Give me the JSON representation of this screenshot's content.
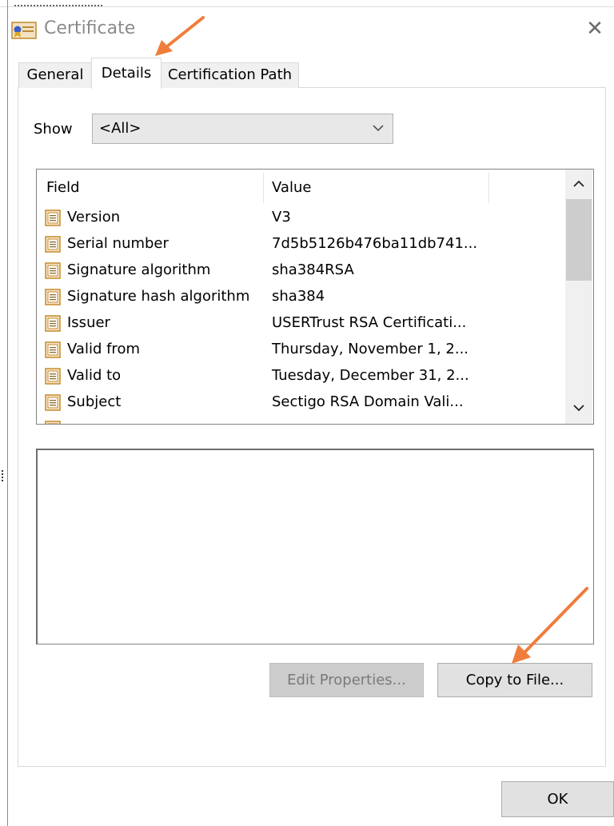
{
  "window": {
    "title": "Certificate",
    "close_glyph": "✕"
  },
  "tabs": [
    {
      "label": "General",
      "active": false
    },
    {
      "label": "Details",
      "active": true
    },
    {
      "label": "Certification Path",
      "active": false
    }
  ],
  "show": {
    "label": "Show",
    "selected": "<All>"
  },
  "list": {
    "columns": [
      "Field",
      "Value"
    ],
    "rows": [
      {
        "field": "Version",
        "value": "V3"
      },
      {
        "field": "Serial number",
        "value": "7d5b5126b476ba11db741..."
      },
      {
        "field": "Signature algorithm",
        "value": "sha384RSA"
      },
      {
        "field": "Signature hash algorithm",
        "value": "sha384"
      },
      {
        "field": "Issuer",
        "value": "USERTrust RSA Certificati..."
      },
      {
        "field": "Valid from",
        "value": "Thursday, November 1, 2..."
      },
      {
        "field": "Valid to",
        "value": "Tuesday, December 31, 2..."
      },
      {
        "field": "Subject",
        "value": "Sectigo RSA Domain Vali..."
      }
    ]
  },
  "detail_text": "",
  "buttons": {
    "edit_properties": "Edit Properties...",
    "copy_to_file": "Copy to File...",
    "ok": "OK"
  },
  "colors": {
    "annotation_arrow": "#f07d3c",
    "title_text": "#8b8b8b"
  },
  "icons": {
    "title": "certificate-icon",
    "row": "field-property-icon"
  }
}
